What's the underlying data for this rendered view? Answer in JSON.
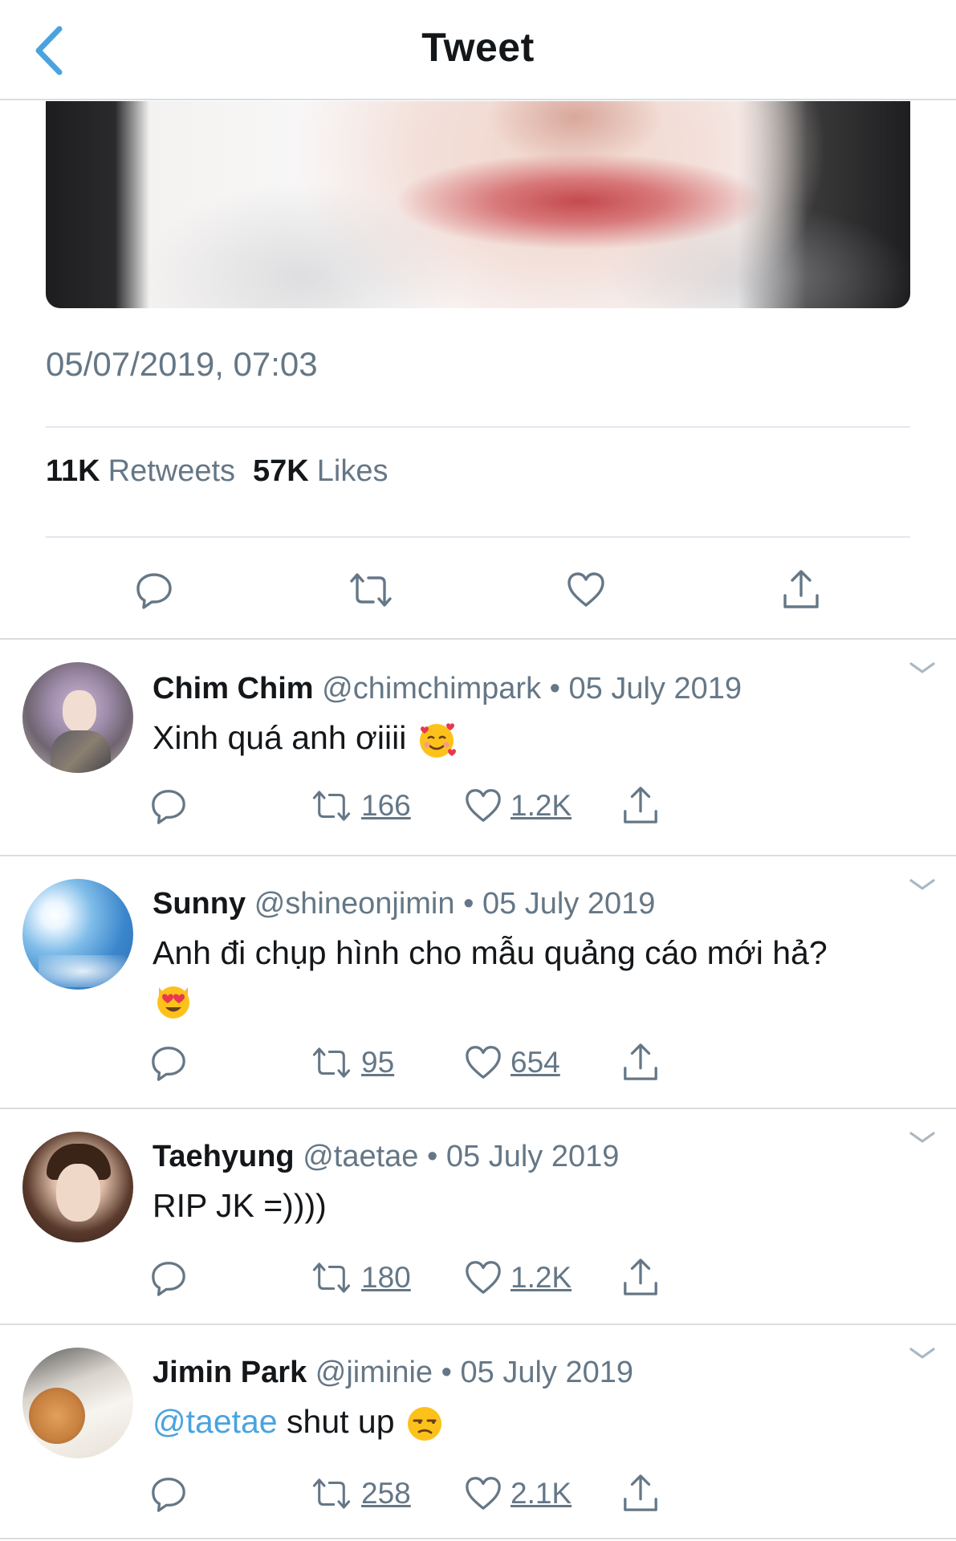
{
  "header": {
    "title": "Tweet",
    "back_icon": "chevron-left-icon"
  },
  "colors": {
    "accent": "#4aa3df",
    "secondary_text": "#657786",
    "divider": "#e1e8ed"
  },
  "tweet": {
    "timestamp": "05/07/2019, 07:03",
    "retweets_count": "11K",
    "retweets_label": "Retweets",
    "likes_count": "57K",
    "likes_label": "Likes",
    "action_icons": [
      "reply-icon",
      "retweet-icon",
      "like-icon",
      "share-icon"
    ]
  },
  "replies": [
    {
      "name": "Chim Chim",
      "handle": "@chimchimpark",
      "dot": "•",
      "date": "05 July 2019",
      "text": "Xinh quá anh ơiiii",
      "emoji": "smiling-face-with-hearts",
      "retweets": "166",
      "likes": "1.2K"
    },
    {
      "name": "Sunny",
      "handle": "@shineonjimin",
      "dot": "•",
      "date": "05 July 2019",
      "text": "Anh đi chụp hình cho mẫu quảng cáo mới hả?",
      "emoji": "heart-eyes-cat",
      "retweets": "95",
      "likes": "654"
    },
    {
      "name": "Taehyung",
      "handle": "@taetae",
      "dot": "•",
      "date": "05 July 2019",
      "text": "RIP JK =))))",
      "retweets": "180",
      "likes": "1.2K"
    },
    {
      "name": "Jimin Park",
      "handle": "@jiminie",
      "dot": "•",
      "date": "05 July 2019",
      "mention": "@taetae",
      "text": " shut up",
      "emoji": "unamused-face",
      "retweets": "258",
      "likes": "2.1K"
    }
  ]
}
